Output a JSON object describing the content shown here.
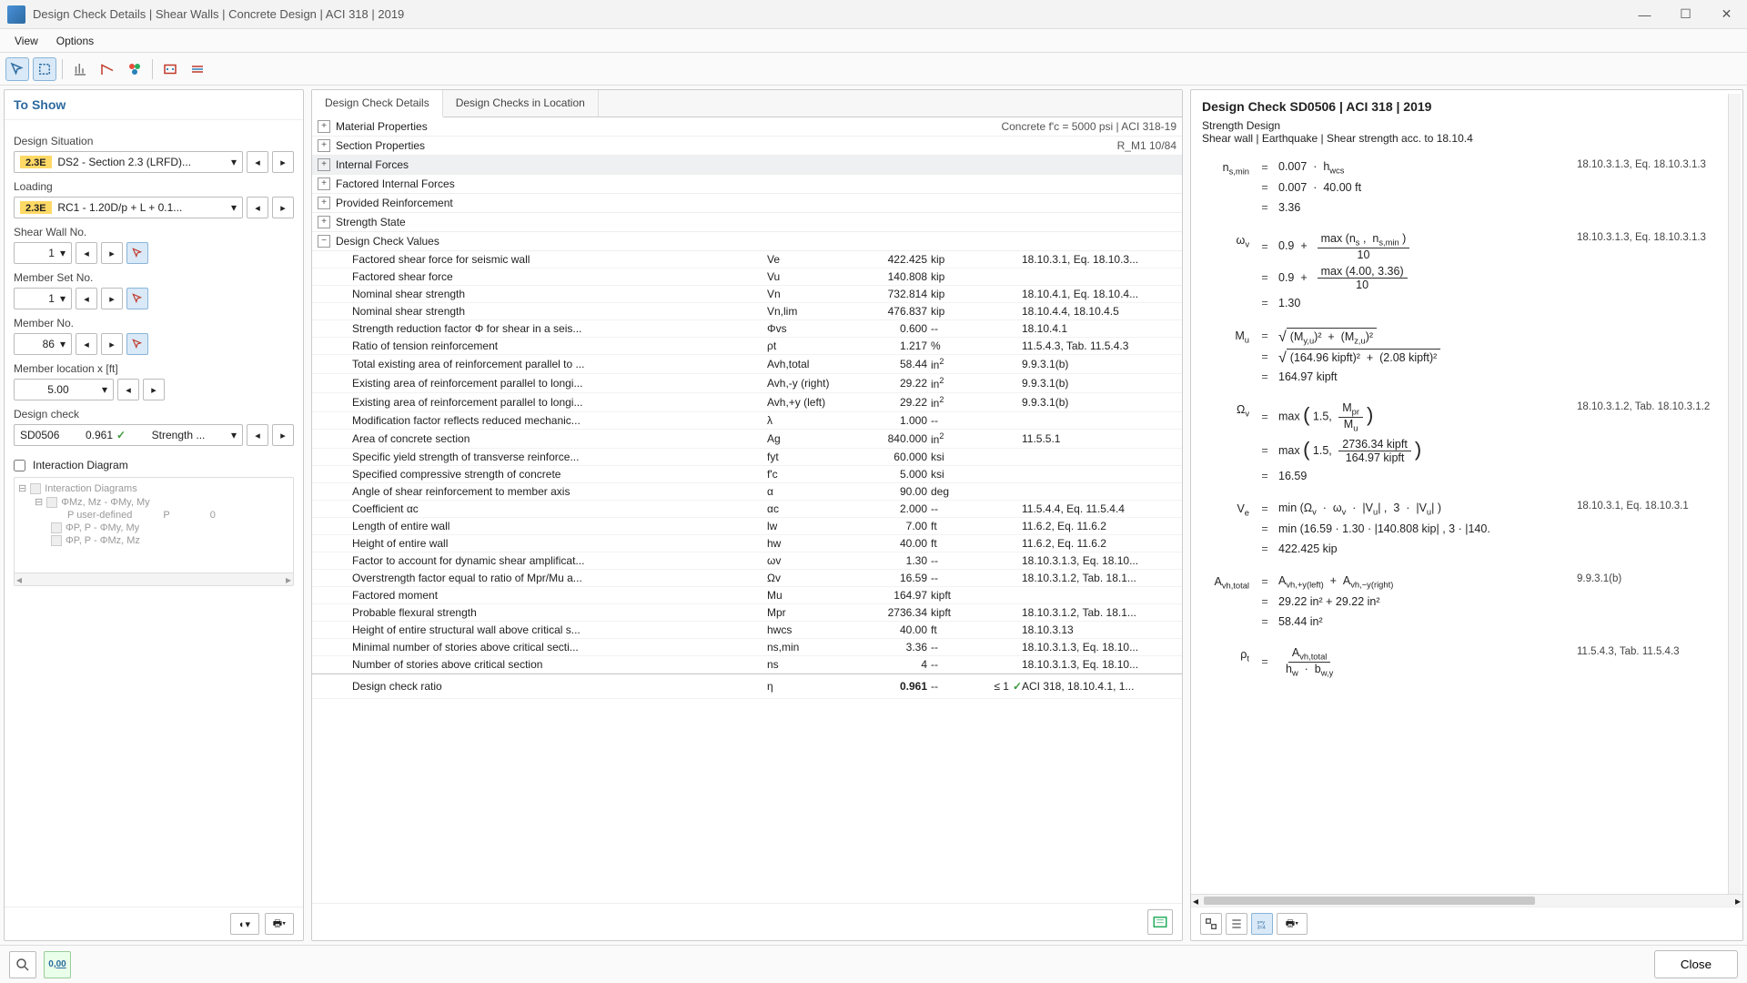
{
  "window": {
    "title": "Design Check Details | Shear Walls | Concrete Design | ACI 318 | 2019"
  },
  "menu": {
    "view": "View",
    "options": "Options"
  },
  "sidebar": {
    "header": "To Show",
    "design_situation_lbl": "Design Situation",
    "design_situation_pill": "2.3E",
    "design_situation_val": "DS2 - Section 2.3 (LRFD)...",
    "loading_lbl": "Loading",
    "loading_pill": "2.3E",
    "loading_val": "RC1 - 1.20D/p + L + 0.1...",
    "shear_wall_lbl": "Shear Wall No.",
    "shear_wall_val": "1",
    "member_set_lbl": "Member Set No.",
    "member_set_val": "1",
    "member_no_lbl": "Member No.",
    "member_no_val": "86",
    "member_loc_lbl": "Member location x [ft]",
    "member_loc_val": "5.00",
    "design_check_lbl": "Design check",
    "dc_code": "SD0506",
    "dc_ratio": "0.961",
    "dc_title": "Strength ...",
    "interaction_lbl": "Interaction Diagram",
    "tree": {
      "r1": "Interaction Diagrams",
      "r2": "ΦMz, Mz - ΦMy, My",
      "r3l": "P user-defined",
      "r3p": "P",
      "r3v": "0",
      "r4": "ΦP, P - ΦMy, My",
      "r5": "ΦP, P - ΦMz, Mz"
    }
  },
  "center": {
    "tab1": "Design Check Details",
    "tab2": "Design Checks in Location",
    "sections": {
      "material": "Material Properties",
      "material_meta": "Concrete f'c = 5000 psi | ACI 318-19",
      "section": "Section Properties",
      "section_meta": "R_M1 10/84",
      "internal": "Internal Forces",
      "factored": "Factored Internal Forces",
      "provided": "Provided Reinforcement",
      "strength": "Strength State",
      "values": "Design Check Values"
    },
    "rows": [
      {
        "label": "Factored shear force for seismic wall",
        "sym": "Ve",
        "val": "422.425",
        "unit": "kip",
        "ref": "18.10.3.1, Eq. 18.10.3..."
      },
      {
        "label": "Factored shear force",
        "sym": "Vu",
        "val": "140.808",
        "unit": "kip",
        "ref": ""
      },
      {
        "label": "Nominal shear strength",
        "sym": "Vn",
        "val": "732.814",
        "unit": "kip",
        "ref": "18.10.4.1, Eq. 18.10.4..."
      },
      {
        "label": "Nominal shear strength",
        "sym": "Vn,lim",
        "val": "476.837",
        "unit": "kip",
        "ref": "18.10.4.4, 18.10.4.5"
      },
      {
        "label": "Strength reduction factor Φ for shear in a seis...",
        "sym": "Φvs",
        "val": "0.600",
        "unit": "--",
        "ref": "18.10.4.1"
      },
      {
        "label": "Ratio of tension reinforcement",
        "sym": "ρt",
        "val": "1.217",
        "unit": "%",
        "ref": "11.5.4.3, Tab. 11.5.4.3"
      },
      {
        "label": "Total existing area of reinforcement parallel to ...",
        "sym": "Avh,total",
        "val": "58.44",
        "unit": "in²",
        "ref": "9.9.3.1(b)"
      },
      {
        "label": "Existing area of reinforcement parallel to longi...",
        "sym": "Avh,-y (right)",
        "val": "29.22",
        "unit": "in²",
        "ref": "9.9.3.1(b)"
      },
      {
        "label": "Existing area of reinforcement parallel to longi...",
        "sym": "Avh,+y (left)",
        "val": "29.22",
        "unit": "in²",
        "ref": "9.9.3.1(b)"
      },
      {
        "label": "Modification factor reflects reduced mechanic...",
        "sym": "λ",
        "val": "1.000",
        "unit": "--",
        "ref": ""
      },
      {
        "label": "Area of concrete section",
        "sym": "Ag",
        "val": "840.000",
        "unit": "in²",
        "ref": "11.5.5.1"
      },
      {
        "label": "Specific yield strength of transverse reinforce...",
        "sym": "fyt",
        "val": "60.000",
        "unit": "ksi",
        "ref": ""
      },
      {
        "label": "Specified compressive strength of concrete",
        "sym": "f'c",
        "val": "5.000",
        "unit": "ksi",
        "ref": ""
      },
      {
        "label": "Angle of shear reinforcement to member axis",
        "sym": "α",
        "val": "90.00",
        "unit": "deg",
        "ref": ""
      },
      {
        "label": "Coefficient αc",
        "sym": "αc",
        "val": "2.000",
        "unit": "--",
        "ref": "11.5.4.4, Eq. 11.5.4.4"
      },
      {
        "label": "Length of entire wall",
        "sym": "lw",
        "val": "7.00",
        "unit": "ft",
        "ref": "11.6.2, Eq. 11.6.2"
      },
      {
        "label": "Height of entire wall",
        "sym": "hw",
        "val": "40.00",
        "unit": "ft",
        "ref": "11.6.2, Eq. 11.6.2"
      },
      {
        "label": "Factor to account for dynamic shear amplificat...",
        "sym": "ωv",
        "val": "1.30",
        "unit": "--",
        "ref": "18.10.3.1.3, Eq. 18.10..."
      },
      {
        "label": "Overstrength factor equal to ratio of Mpr/Mu a...",
        "sym": "Ωv",
        "val": "16.59",
        "unit": "--",
        "ref": "18.10.3.1.2, Tab. 18.1..."
      },
      {
        "label": "Factored moment",
        "sym": "Mu",
        "val": "164.97",
        "unit": "kipft",
        "ref": ""
      },
      {
        "label": "Probable flexural strength",
        "sym": "Mpr",
        "val": "2736.34",
        "unit": "kipft",
        "ref": "18.10.3.1.2, Tab. 18.1..."
      },
      {
        "label": "Height of entire structural wall above critical s...",
        "sym": "hwcs",
        "val": "40.00",
        "unit": "ft",
        "ref": "18.10.3.13"
      },
      {
        "label": "Minimal number of stories above critical secti...",
        "sym": "ns,min",
        "val": "3.36",
        "unit": "--",
        "ref": "18.10.3.1.3, Eq. 18.10..."
      },
      {
        "label": "Number of stories above critical section",
        "sym": "ns",
        "val": "4",
        "unit": "--",
        "ref": "18.10.3.1.3, Eq. 18.10..."
      }
    ],
    "ratio_row": {
      "label": "Design check ratio",
      "sym": "η",
      "val": "0.961",
      "unit": "--",
      "lim": "≤ 1",
      "ref": "ACI 318, 18.10.4.1, 1..."
    }
  },
  "right": {
    "title": "Design Check SD0506 | ACI 318 | 2019",
    "sub1": "Strength Design",
    "sub2": "Shear wall | Earthquake | Shear strength acc. to 18.10.4",
    "refs": {
      "nsmin": "18.10.3.1.3, Eq. 18.10.3.1.3",
      "omegav": "18.10.3.1.3, Eq. 18.10.3.1.3",
      "Omega": "18.10.3.1.2, Tab. 18.10.3.1.2",
      "Ve": "18.10.3.1, Eq. 18.10.3.1",
      "Avh": "9.9.3.1(b)",
      "rhot": "11.5.4.3, Tab. 11.5.4.3"
    },
    "vals": {
      "nsmin1": "0.007",
      "nsmin_mul": "·",
      "hwcs": "hwcs",
      "nsmin2a": "0.007",
      "nsmin2b": "40.00 ft",
      "nsmin3": "3.36",
      "ov1": "0.9",
      "ov_num1a": "max (ns,",
      "ov_num1b": "ns,min )",
      "ov_den": "10",
      "ov2_num": "max (4.00,  3.36)",
      "ov3": "1.30",
      "Mu_sqrt1a": "(My,u)²",
      "Mu_sqrt1b": "(Mz,u)²",
      "Mu_sqrt2a": "(164.96 kipft)²",
      "Mu_sqrt2b": "(2.08 kipft)²",
      "Mu_res": "164.97 kipft",
      "Om_max": "max",
      "Om_15": "1.5,",
      "Om_num1": "Mpr",
      "Om_den1": "Mu",
      "Om_num2": "2736.34 kipft",
      "Om_den2": "164.97 kipft",
      "Om_res": "16.59",
      "Ve1": "min (Ωv  ·  ωv  ·  |Vu| ,  3  ·  |Vu| )",
      "Ve2": "min (16.59  ·  1.30  ·  |140.808 kip| ,  3  ·  |140.",
      "Ve3": "422.425 kip",
      "Avh1a": "Avh,+y(left)",
      "Avh1b": "Avh,−y(right)",
      "Avh2": "29.22 in²  +  29.22 in²",
      "Avh3": "58.44 in²",
      "rhot_num": "Avh,total",
      "rhot_den": "hw  ·  bw,y"
    }
  },
  "footer": {
    "close": "Close"
  }
}
